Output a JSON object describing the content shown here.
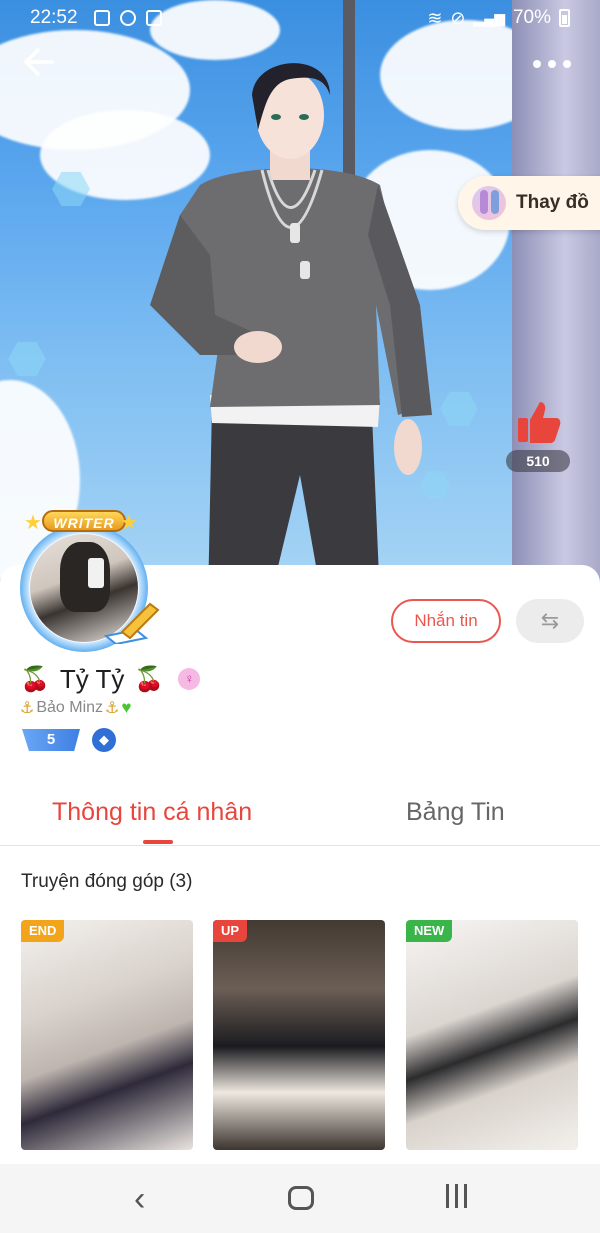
{
  "status_bar": {
    "time": "22:52",
    "battery": "70%"
  },
  "hero": {
    "change_outfit_label": "Thay đồ",
    "like_count": "510"
  },
  "profile": {
    "badge": "WRITER",
    "display_name": "Tỷ Tỷ",
    "sub_name": "Bảo Minz",
    "level": "5",
    "message_button": "Nhắn tin",
    "swap_symbol": "⇆"
  },
  "tabs": [
    {
      "label": "Thông tin cá nhân",
      "active": true
    },
    {
      "label": "Bảng Tin",
      "active": false
    }
  ],
  "contributions": {
    "title": "Truyện đóng góp (3)",
    "stories": [
      {
        "tag": "END",
        "tag_color": "#f2a51a"
      },
      {
        "tag": "UP",
        "tag_color": "#e8453c"
      },
      {
        "tag": "NEW",
        "tag_color": "#39b54a"
      }
    ]
  },
  "colors": {
    "accent": "#e8453c"
  }
}
